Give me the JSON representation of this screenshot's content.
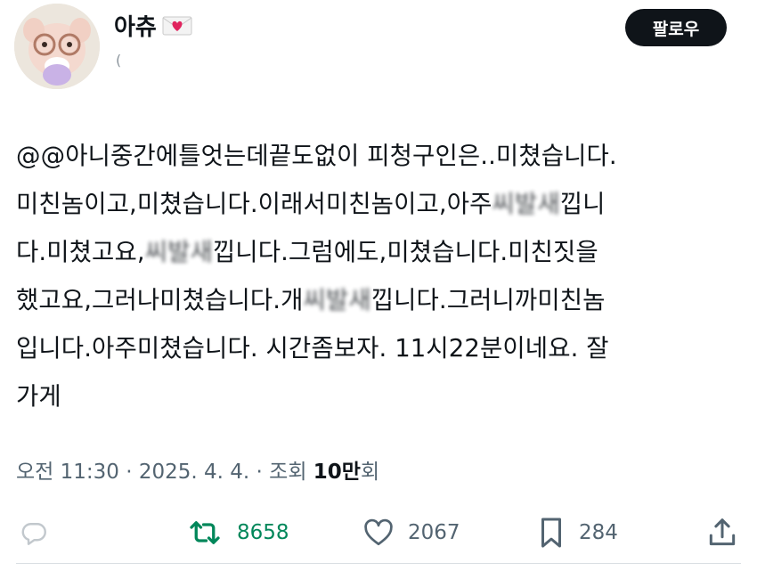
{
  "user": {
    "display_name": "아츄",
    "handle": "(",
    "follow_label": "팔로우"
  },
  "tweet": {
    "lines": [
      [
        {
          "t": "@@아니중간에틀엇는데끝도없이 피청구인은..미쳤습니다."
        }
      ],
      [
        {
          "t": "미친놈이고,미쳤습니다.이래서미친놈이고,아주"
        },
        {
          "t": "씨발새",
          "blur": true
        },
        {
          "t": "낍니"
        }
      ],
      [
        {
          "t": "다.미쳤고요,"
        },
        {
          "t": "씨발새",
          "blur": true
        },
        {
          "t": "낍니다.그럼에도,미쳤습니다.미친짓을"
        }
      ],
      [
        {
          "t": "했고요,그러나미쳤습니다.개"
        },
        {
          "t": "씨발새",
          "blur": true
        },
        {
          "t": "낍니다.그러니까미친놈"
        }
      ],
      [
        {
          "t": "입니다.아주미쳤습니다. 시간좀보자. 11시22분이네요. 잘"
        }
      ],
      [
        {
          "t": "가게"
        }
      ]
    ]
  },
  "meta": {
    "time": "오전 11:30",
    "sep1": " · ",
    "date": "2025. 4. 4.",
    "sep2": " · ",
    "views_label_prefix": "조회 ",
    "views_count": "10만",
    "views_label_suffix": "회"
  },
  "actions": {
    "reply": {
      "icon": "reply-bubble-icon",
      "count": ""
    },
    "retweet": {
      "icon": "retweet-icon",
      "count": "8658"
    },
    "like": {
      "icon": "heart-outline-icon",
      "count": "2067"
    },
    "bookmark": {
      "icon": "bookmark-icon",
      "count": "284"
    },
    "share": {
      "icon": "share-upload-icon",
      "count": ""
    }
  },
  "colors": {
    "text": "#0f1419",
    "secondary": "#536471",
    "retweet_green": "#00875a",
    "button_bg": "#0f1419"
  }
}
